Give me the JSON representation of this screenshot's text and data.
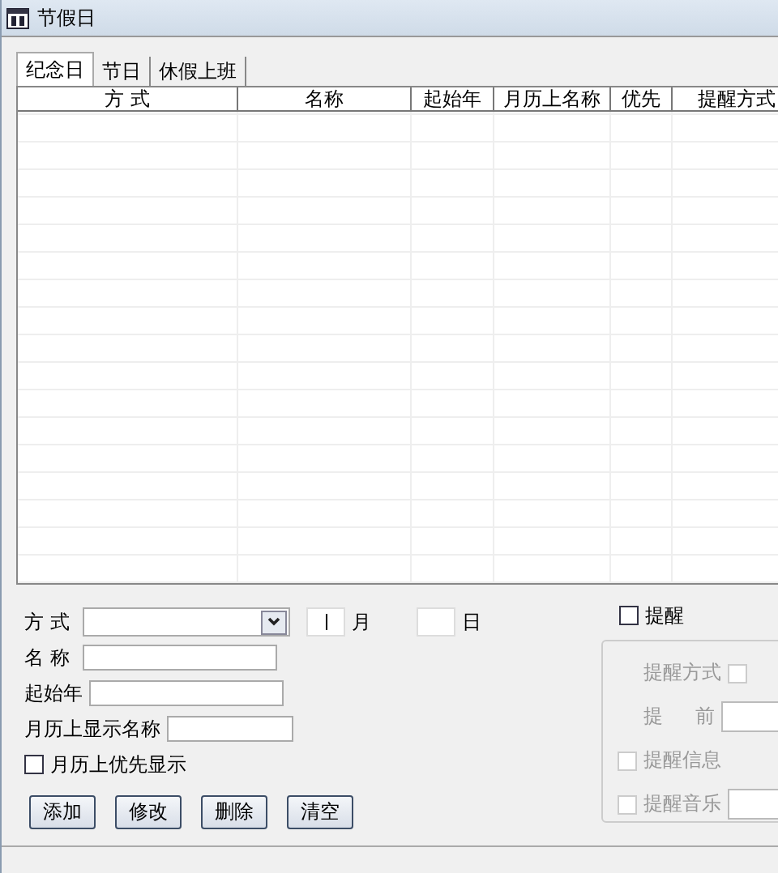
{
  "window": {
    "title": "节假日"
  },
  "tabs": [
    {
      "label": "纪念日",
      "selected": true
    },
    {
      "label": "节日",
      "selected": false
    },
    {
      "label": "休假上班",
      "selected": false
    }
  ],
  "table": {
    "columns": [
      "方 式",
      "名称",
      "起始年",
      "月历上名称",
      "优先",
      "提醒方式"
    ]
  },
  "form": {
    "fields": [
      {
        "label": "方 式",
        "kind": "combo"
      },
      {
        "label": "名 称",
        "kind": "text"
      },
      {
        "label": "起始年",
        "kind": "text"
      },
      {
        "label": "月历上显示名称",
        "kind": "short"
      }
    ],
    "month": {
      "label": "月"
    },
    "day": {
      "label": "日"
    },
    "priority": {
      "label": "月历上优先显示",
      "checked": false
    },
    "buttons": [
      "添加",
      "修改",
      "删除",
      "清空"
    ]
  },
  "reminder": {
    "label": "提醒",
    "checked": false,
    "disabled": true,
    "rows": [
      {
        "kind": "option",
        "label": "提醒方式",
        "checked": false
      },
      {
        "kind": "input",
        "label": "提 前"
      },
      {
        "kind": "check",
        "label": "提醒信息",
        "checked": false
      },
      {
        "kind": "check_input",
        "label": "提醒音乐",
        "checked": false
      }
    ]
  }
}
